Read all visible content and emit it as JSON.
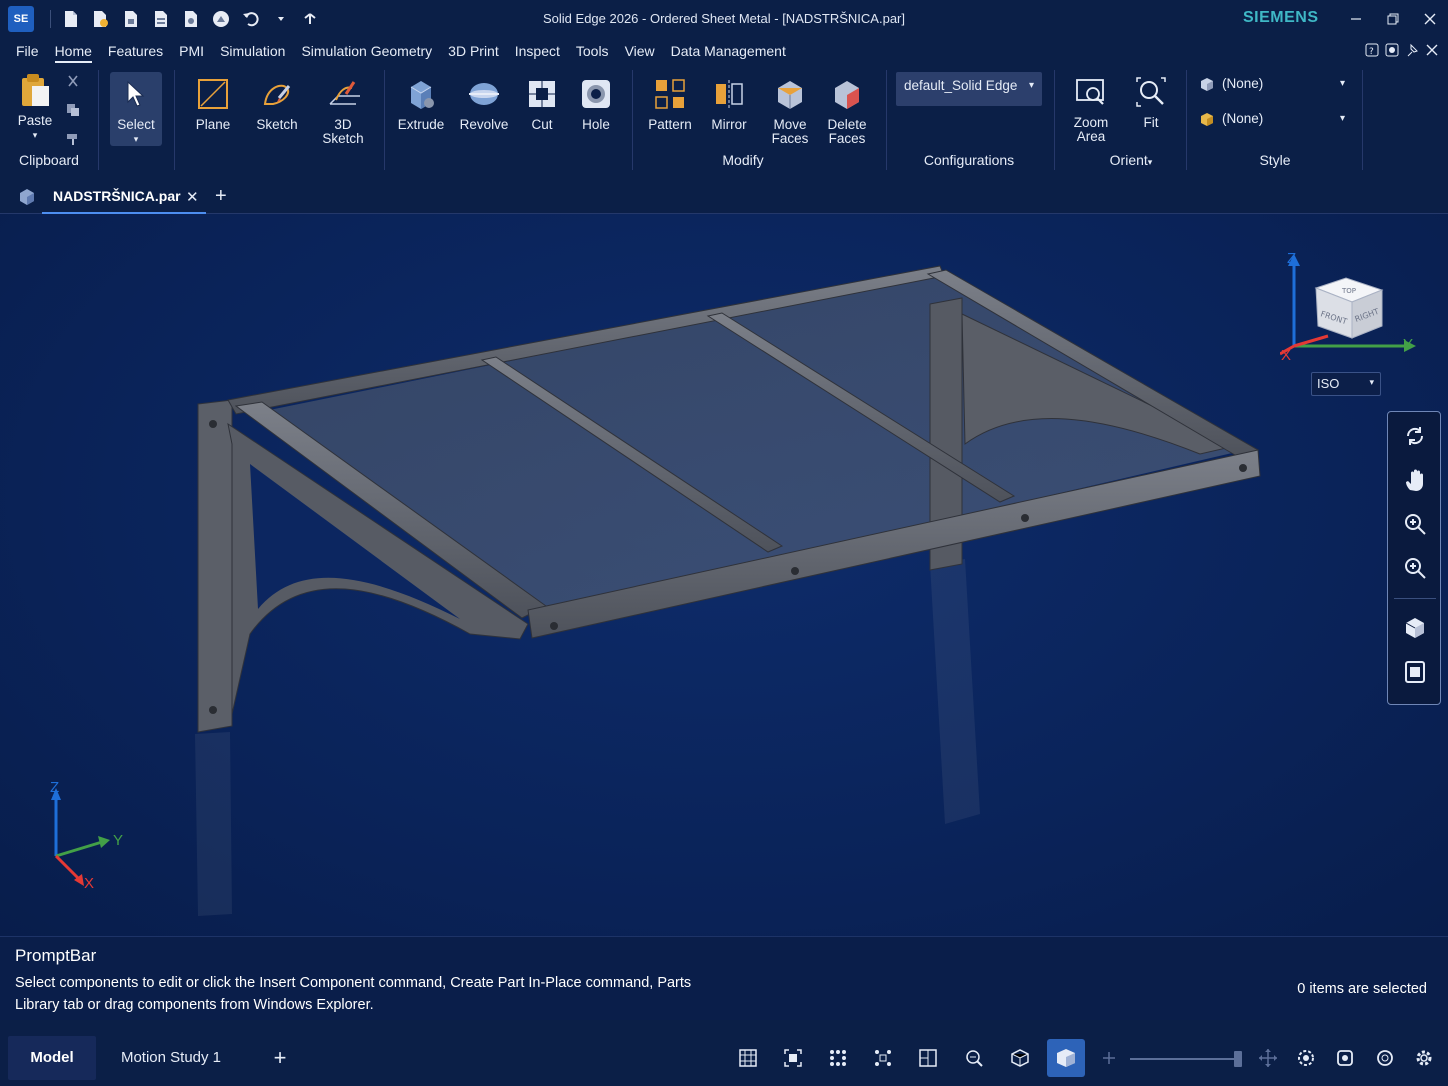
{
  "app": {
    "logo": "SE",
    "window_title": "Solid Edge 2026 - Ordered Sheet Metal - [NADSTRŠNICA.par]",
    "brand": "SIEMENS"
  },
  "quick_access": [
    "new-icon",
    "open-icon",
    "save-icon",
    "save-as-icon",
    "print-icon",
    "share-icon",
    "undo-icon",
    "redo-icon"
  ],
  "menu": {
    "items": [
      "File",
      "Home",
      "Features",
      "PMI",
      "Simulation",
      "Simulation Geometry",
      "3D Print",
      "Inspect",
      "Tools",
      "View",
      "Data Management"
    ],
    "active": "Home"
  },
  "ribbon": {
    "clipboard": {
      "paste": "Paste",
      "group": "Clipboard"
    },
    "select": "Select",
    "sketch_group": {
      "plane": "Plane",
      "sketch": "Sketch",
      "sketch3d_line1": "3D",
      "sketch3d_line2": "Sketch"
    },
    "features": {
      "extrude": "Extrude",
      "revolve": "Revolve",
      "cut": "Cut",
      "hole": "Hole"
    },
    "modify": {
      "pattern": "Pattern",
      "mirror": "Mirror",
      "move_faces_line1": "Move",
      "move_faces_line2": "Faces",
      "delete_faces_line1": "Delete",
      "delete_faces_line2": "Faces",
      "group": "Modify"
    },
    "configurations": {
      "value": "default_Solid Edge",
      "group": "Configurations"
    },
    "orient": {
      "zoom_area_line1": "Zoom",
      "zoom_area_line2": "Area",
      "fit": "Fit",
      "group": "Orient"
    },
    "style": {
      "face_style": "(None)",
      "part_style": "(None)",
      "group": "Style"
    }
  },
  "document_tab": {
    "name": "NADSTRŠNICA.par",
    "close": "✕",
    "add": "+"
  },
  "viewport": {
    "view_orientation": "ISO",
    "navcube_faces": {
      "top": "TOP",
      "front": "FRONT",
      "right": "RIGHT"
    },
    "axes": {
      "x": "X",
      "y": "Y",
      "z": "Z"
    },
    "colors": {
      "x_axis": "#e53935",
      "y_axis": "#43a047",
      "z_axis": "#1e6fd9",
      "background": "#0a2359"
    }
  },
  "promptbar": {
    "title": "PromptBar",
    "message": "Select components to edit or click the Insert Component command, Create Part In-Place command, Parts Library tab or drag components from Windows Explorer.",
    "status": "0 items are selected"
  },
  "statusbar": {
    "tabs": [
      "Model",
      "Motion Study 1"
    ],
    "active_tab": "Model",
    "add": "+"
  }
}
